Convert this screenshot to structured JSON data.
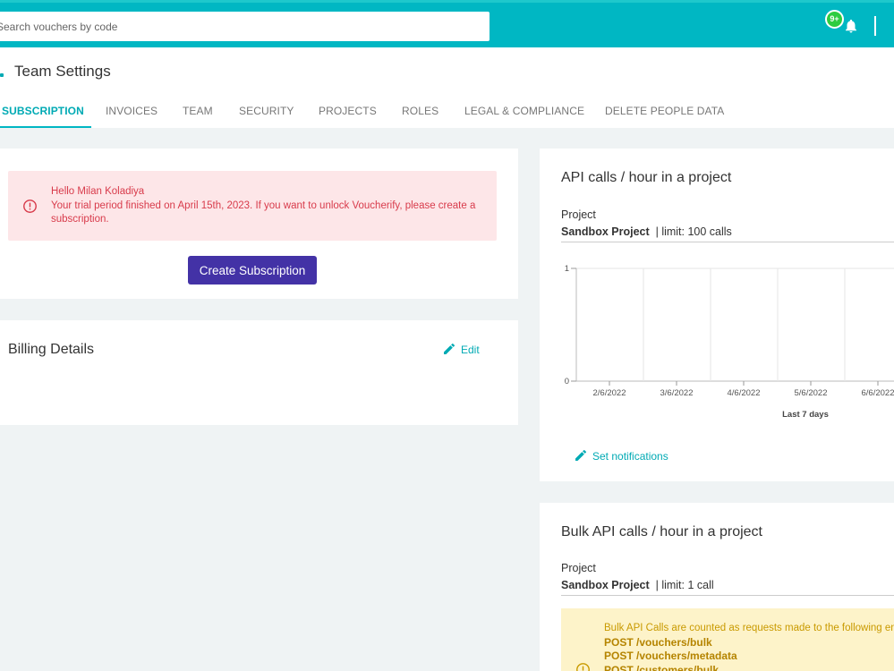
{
  "topbar": {
    "search_placeholder": "Search vouchers by code",
    "notification_badge": "9+"
  },
  "page": {
    "title": "Team Settings",
    "tabs": [
      {
        "label": "SUBSCRIPTION",
        "active": true
      },
      {
        "label": "INVOICES"
      },
      {
        "label": "TEAM"
      },
      {
        "label": "SECURITY"
      },
      {
        "label": "PROJECTS"
      },
      {
        "label": "ROLES"
      },
      {
        "label": "LEGAL & COMPLIANCE"
      },
      {
        "label": "DELETE PEOPLE DATA"
      }
    ]
  },
  "subscription": {
    "greeting": "Hello Milan Koladiya",
    "message": "Your trial period finished on April 15th, 2023. If you want to unlock Voucherify, please create a subscription.",
    "button_label": "Create Subscription"
  },
  "billing": {
    "title": "Billing Details",
    "edit_label": "Edit"
  },
  "api_calls": {
    "title": "API calls / hour in a project",
    "project_label": "Project",
    "project_name": "Sandbox Project",
    "limit_text": "| limit: 100 calls",
    "set_notifications_label": "Set notifications"
  },
  "chart_data": {
    "type": "bar",
    "categories": [
      "2/6/2022",
      "3/6/2022",
      "4/6/2022",
      "5/6/2022",
      "6/6/2022"
    ],
    "values": [
      0,
      0,
      0,
      0,
      0
    ],
    "xlabel": "Last 7 days",
    "ylabel": "",
    "ylim": [
      0,
      1
    ],
    "yticks": [
      "1",
      "0"
    ],
    "grid": true
  },
  "bulk_api_calls": {
    "title": "Bulk API calls / hour in a project",
    "project_label": "Project",
    "project_name": "Sandbox Project",
    "limit_text": "| limit: 1 call",
    "notice": "Bulk API Calls are counted as requests made to the following end",
    "endpoints": [
      "POST /vouchers/bulk",
      "POST /vouchers/metadata",
      "POST /customers/bulk"
    ]
  },
  "colors": {
    "accent": "#00b7c3",
    "primary_button": "#4332a6",
    "error": "#d83b4b",
    "warning": "#c99a00"
  }
}
